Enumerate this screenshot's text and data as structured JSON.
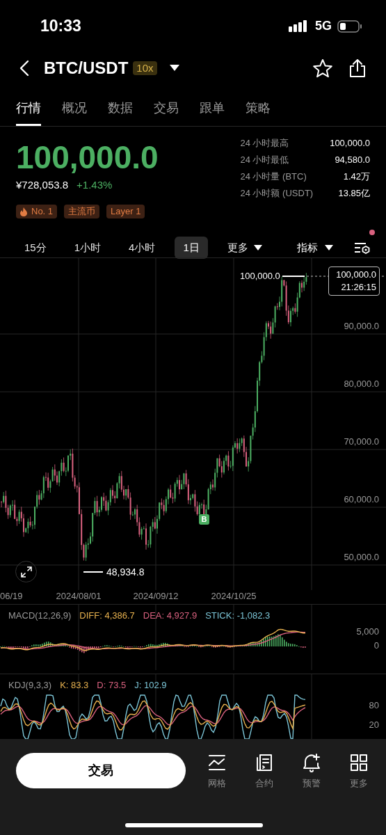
{
  "status_bar": {
    "time": "10:33",
    "network": "5G"
  },
  "header": {
    "pair": "BTC/USDT",
    "leverage": "10x"
  },
  "tabs": [
    {
      "label": "行情",
      "selected": true
    },
    {
      "label": "概况",
      "selected": false
    },
    {
      "label": "数据",
      "selected": false
    },
    {
      "label": "交易",
      "selected": false
    },
    {
      "label": "跟单",
      "selected": false
    },
    {
      "label": "策略",
      "selected": false
    }
  ],
  "price": {
    "last": "100,000.0",
    "cny": "¥728,053.8",
    "change": "+1.43%"
  },
  "stats": [
    {
      "label": "24 小时最高",
      "value": "100,000.0"
    },
    {
      "label": "24 小时最低",
      "value": "94,580.0"
    },
    {
      "label": "24 小时量 (BTC)",
      "value": "1.42万"
    },
    {
      "label": "24 小时额 (USDT)",
      "value": "13.85亿"
    }
  ],
  "tags": [
    {
      "label": "No. 1",
      "kind": "hot"
    },
    {
      "label": "主流币",
      "kind": "plain"
    },
    {
      "label": "Layer 1",
      "kind": "plain"
    }
  ],
  "intervals": [
    {
      "label": "15分",
      "kind": "plain",
      "selected": false
    },
    {
      "label": "1小时",
      "kind": "plain",
      "selected": false
    },
    {
      "label": "4小时",
      "kind": "plain",
      "selected": false
    },
    {
      "label": "1日",
      "kind": "plain",
      "selected": true
    },
    {
      "label": "更多",
      "kind": "menu",
      "selected": false
    }
  ],
  "indicator_menu": {
    "label": "指标"
  },
  "chart_settings": {
    "notification": true
  },
  "chart": {
    "price_axis": [
      "90,000.0",
      "80,000.0",
      "70,000.0",
      "60,000.0",
      "50,000.0"
    ],
    "high_label": "100,000.0",
    "low_label": "48,934.8",
    "last_price": "100,000.0",
    "countdown": "21:26:15",
    "marker": "B",
    "dates": [
      "06/19",
      "2024/08/01",
      "2024/09/12",
      "2024/10/25"
    ]
  },
  "macd": {
    "title": "MACD(12,26,9)",
    "readings": [
      {
        "label": "DIFF: 4,386.7",
        "color": "#e8b24f"
      },
      {
        "label": "DEA: 4,927.9",
        "color": "#d9617f"
      },
      {
        "label": "STICK: -1,082.3",
        "color": "#7cc6d8"
      }
    ],
    "axis": [
      "5,000",
      "0"
    ]
  },
  "kdj": {
    "title": "KDJ(9,3,3)",
    "readings": [
      {
        "label": "K: 83.3",
        "color": "#e8b24f"
      },
      {
        "label": "D: 73.5",
        "color": "#d9617f"
      },
      {
        "label": "J: 102.9",
        "color": "#7cc6d8"
      }
    ],
    "axis": [
      "80",
      "20"
    ]
  },
  "bottom_bar": {
    "trade_button": "交易",
    "actions": [
      {
        "label": "网格",
        "kind": "grid"
      },
      {
        "label": "合约",
        "kind": "contract"
      },
      {
        "label": "预警",
        "kind": "alert"
      },
      {
        "label": "更多",
        "kind": "more"
      }
    ]
  }
}
